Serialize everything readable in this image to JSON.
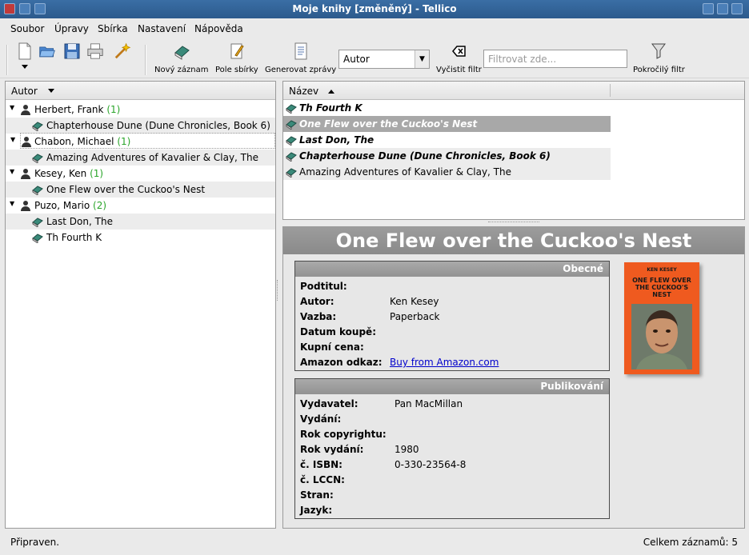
{
  "window": {
    "title": "Moje knihy [změněný] - Tellico"
  },
  "menu": {
    "items": [
      "Soubor",
      "Úpravy",
      "Sbírka",
      "Nastavení",
      "Nápověda"
    ]
  },
  "toolbar": {
    "new_entry": "Nový záznam",
    "collection_fields": "Pole sbírky",
    "generate_reports": "Generovat zprávy",
    "group_combo_value": "Autor",
    "clear_filter": "Vyčistit filtr",
    "filter_placeholder": "Filtrovat zde...",
    "advanced_filter": "Pokročilý filtr"
  },
  "group_view": {
    "header": "Autor",
    "groups": [
      {
        "author": "Herbert, Frank",
        "count": "(1)",
        "books": [
          "Chapterhouse Dune (Dune Chronicles, Book 6)"
        ]
      },
      {
        "author": "Chabon, Michael",
        "count": "(1)",
        "books": [
          "Amazing Adventures of Kavalier & Clay, The"
        ]
      },
      {
        "author": "Kesey, Ken",
        "count": "(1)",
        "books": [
          "One Flew over the Cuckoo's Nest"
        ]
      },
      {
        "author": "Puzo, Mario",
        "count": "(2)",
        "books": [
          "Last Don, The",
          "Th Fourth K"
        ]
      }
    ]
  },
  "list_view": {
    "header": "Název",
    "rows": [
      "Th Fourth K",
      "One Flew over the Cuckoo's Nest",
      "Last Don, The",
      "Chapterhouse Dune (Dune Chronicles, Book 6)",
      "Amazing Adventures of Kavalier & Clay, The"
    ]
  },
  "entry": {
    "title": "One Flew over the Cuckoo's Nest",
    "general": {
      "header": "Obecné",
      "subtitle_label": "Podtitul:",
      "author_label": "Autor:",
      "author": "Ken Kesey",
      "binding_label": "Vazba:",
      "binding": "Paperback",
      "purchase_date_label": "Datum koupě:",
      "price_label": "Kupní cena:",
      "amazon_label": "Amazon odkaz:",
      "amazon_link": "Buy from Amazon.com"
    },
    "publishing": {
      "header": "Publikování",
      "publisher_label": "Vydavatel:",
      "publisher": "Pan MacMillan",
      "edition_label": "Vydání:",
      "copyright_label": "Rok copyrightu:",
      "pub_year_label": "Rok vydání:",
      "pub_year": "1980",
      "isbn_label": "č. ISBN:",
      "isbn": "0-330-23564-8",
      "lccn_label": "č. LCCN:",
      "pages_label": "Stran:",
      "language_label": "Jazyk:"
    },
    "cover": {
      "author": "KEN KESEY",
      "title": "ONE FLEW OVER THE CUCKOO'S NEST"
    }
  },
  "status": {
    "left": "Připraven.",
    "right": "Celkem záznamů: 5"
  }
}
